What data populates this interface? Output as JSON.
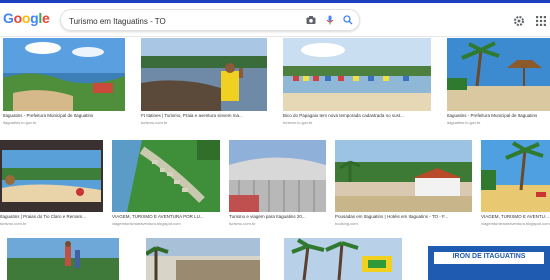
{
  "header": {
    "logo_letters": [
      "G",
      "o",
      "o",
      "g",
      "l",
      "e"
    ],
    "search_query": "Turismo em Itaguatins - TO"
  },
  "images": [
    {
      "caption": "Itaguatins - Prefeitura Municipal de Itaguatins",
      "source": "itaguatins.to.gov.br"
    },
    {
      "caption": "Ft Itatines | Turismo, Praia e aventura sinvem ma...",
      "source": "turismo.com.br"
    },
    {
      "caption": "Bico do Papagaio tem nova temporada cadastrada no sust...",
      "source": "turismo.to.gov.br"
    },
    {
      "caption": "Itaguatins - Prefeitura Municipal de Itaguatins",
      "source": "itaguatins.to.gov.br"
    },
    {
      "caption": "Itaguatins | Praias do Tio Claro e Remam...",
      "source": "turismo.com.br"
    },
    {
      "caption": "VIAGEM, TURISMO E AVENTURA POR LU...",
      "source": "viagemturismoeaventura.blogspot.com"
    },
    {
      "caption": "Turismo e viagem para Itaguatins 20...",
      "source": "turismo.com.br"
    },
    {
      "caption": "Pousadas em Itaguatins | Hotéis em Itaguatins - TO - F...",
      "source": "booking.com"
    },
    {
      "caption": "VIAGEM, TURISMO E AVENTURA POR LU...",
      "source": "viagemturismoeaventura.blogspot.com"
    },
    {
      "caption": "",
      "source": ""
    },
    {
      "caption": "",
      "source": ""
    },
    {
      "caption": "",
      "source": ""
    },
    {
      "caption": "",
      "source": ""
    },
    {
      "caption": "",
      "source": ""
    }
  ],
  "row3_sign_text": "IRON DE ITAGUATINS",
  "colors": {
    "blue": "#4285F4",
    "red": "#EA4335",
    "yellow": "#FBBC05",
    "green": "#34A853",
    "topline": "#1a3fbf"
  }
}
